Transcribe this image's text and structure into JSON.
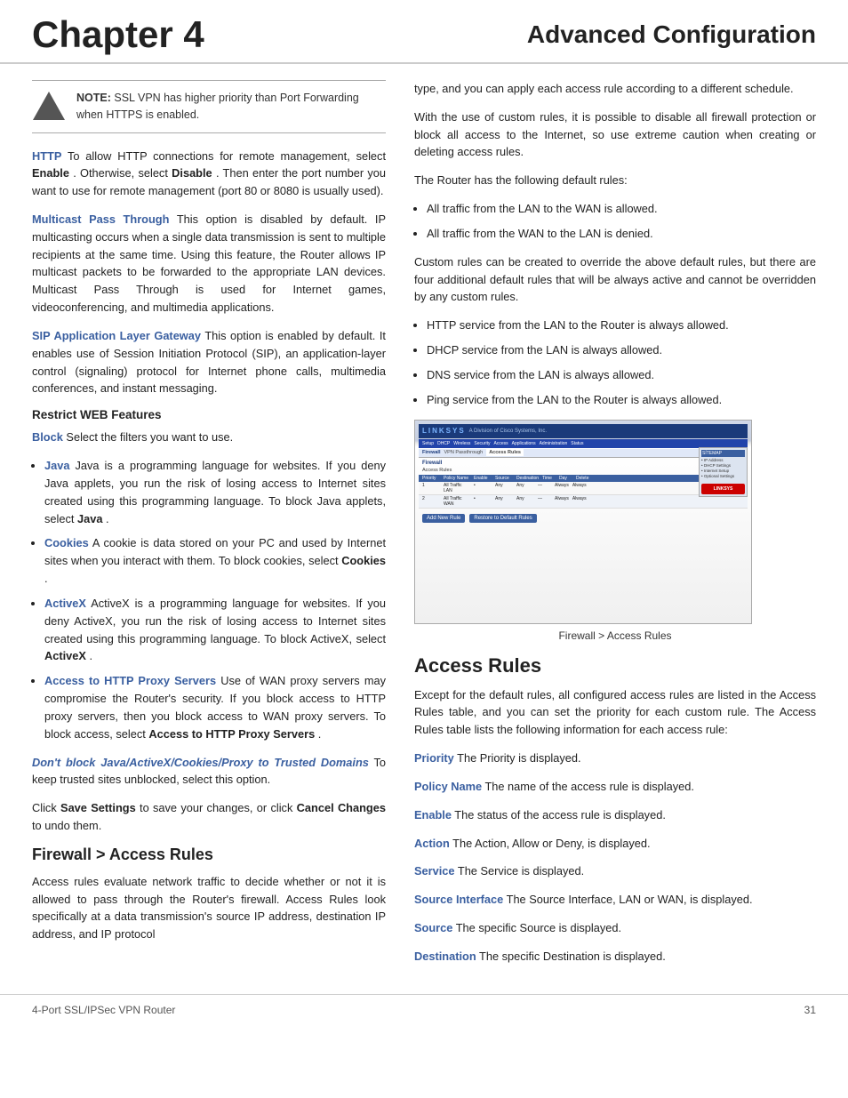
{
  "header": {
    "chapter": "Chapter 4",
    "section": "Advanced Configuration"
  },
  "footer": {
    "product": "4-Port SSL/IPSec VPN Router",
    "page": "31"
  },
  "note": {
    "label": "NOTE:",
    "text": "SSL VPN has higher priority than Port Forwarding when HTTPS is enabled."
  },
  "left": {
    "http": {
      "term": "HTTP",
      "body": "To allow HTTP connections for remote management, select ",
      "enable": "Enable",
      "mid": ". Otherwise, select ",
      "disable": "Disable",
      "end": ". Then enter the port number you want to use for remote management (port 80 or 8080 is usually used)."
    },
    "multicast": {
      "term": "Multicast Pass Through",
      "body": "This option is disabled by default. IP multicasting occurs when a single data transmission is sent to multiple recipients at the same time. Using this feature, the Router allows IP multicast packets to be forwarded to the appropriate LAN devices. Multicast Pass Through is used for Internet games, videoconferencing, and multimedia applications."
    },
    "sip": {
      "term": "SIP Application Layer Gateway",
      "body": " This option is enabled by default. It enables use of Session Initiation Protocol (SIP), an application-layer control (signaling) protocol for Internet phone calls, multimedia conferences, and instant messaging."
    },
    "restrict_heading": "Restrict WEB Features",
    "block_label": "Block",
    "block_body": "  Select the filters you want to use.",
    "bullets": [
      {
        "term": "Java",
        "body": "  Java is a programming language for websites. If you deny Java applets, you run the risk of losing access to Internet sites created using this programming language. To block Java applets, select ",
        "bold": "Java",
        "end": "."
      },
      {
        "term": "Cookies",
        "body": "  A cookie is data stored on your PC and used by Internet sites when you interact with them. To block cookies, select ",
        "bold": "Cookies",
        "end": "."
      },
      {
        "term": "ActiveX",
        "body": "  ActiveX is a programming language for websites. If you deny ActiveX, you run the risk of losing access to Internet sites created using this programming language. To block ActiveX, select ",
        "bold": "ActiveX",
        "end": "."
      },
      {
        "term": "Access to HTTP Proxy Servers",
        "body": "  Use of WAN proxy servers may compromise the Router's security. If you block access to HTTP proxy servers, then you block access to WAN proxy servers. To block access, select ",
        "bold": "Access to HTTP Proxy Servers",
        "end": "."
      }
    ],
    "dont_block": {
      "term": "Don't block Java/ActiveX/Cookies/Proxy to Trusted Domains",
      "body": " To keep trusted sites unblocked, select this option."
    },
    "save_text": "Click ",
    "save_bold": "Save Settings",
    "save_mid": " to save your changes, or click ",
    "cancel_bold": "Cancel Changes",
    "save_end": " to undo them.",
    "firewall_heading": "Firewall > Access Rules",
    "firewall_body": "Access rules evaluate network traffic to decide whether or not it is allowed to pass through the Router's firewall. Access Rules look specifically at a data transmission's source IP address, destination IP address, and IP protocol"
  },
  "right": {
    "intro": "type, and you can apply each access rule according to a different schedule.",
    "para2": "With the use of custom rules, it is possible to disable all firewall protection or block all access to the Internet, so use extreme caution when creating or deleting access rules.",
    "default_rules_label": "The Router has the following default rules:",
    "default_rules": [
      "All traffic from the LAN to the WAN is allowed.",
      "All traffic from the WAN to the LAN is denied."
    ],
    "custom_rules_body": "Custom rules can be created to override the above default rules, but there are four additional default rules that will be always active and cannot be overridden by any custom rules.",
    "always_rules": [
      "HTTP service from the LAN to the Router is always allowed.",
      "DHCP service from the LAN is always allowed.",
      "DNS service from the LAN is always allowed.",
      "Ping service from the LAN to the Router is always allowed."
    ],
    "screenshot_caption": "Firewall > Access Rules",
    "access_rules_heading": "Access Rules",
    "access_rules_intro": "Except for the default rules, all configured access rules are listed in the Access Rules table, and you can set the priority for each custom rule. The Access Rules table lists the following information for each access rule:",
    "fields": [
      {
        "term": "Priority",
        "body": "  The Priority is displayed."
      },
      {
        "term": "Policy Name",
        "body": "  The name of the access rule is displayed."
      },
      {
        "term": "Enable",
        "body": "  The status of the access rule is displayed."
      },
      {
        "term": "Action",
        "body": "  The Action, Allow or Deny, is displayed."
      },
      {
        "term": "Service",
        "body": "  The Service is displayed."
      },
      {
        "term": "Source Interface",
        "body": "  The Source Interface, LAN or WAN, is displayed."
      },
      {
        "term": "Source",
        "body": "  The specific Source is displayed."
      },
      {
        "term": "Destination",
        "body": "  The specific Destination is displayed."
      }
    ]
  }
}
